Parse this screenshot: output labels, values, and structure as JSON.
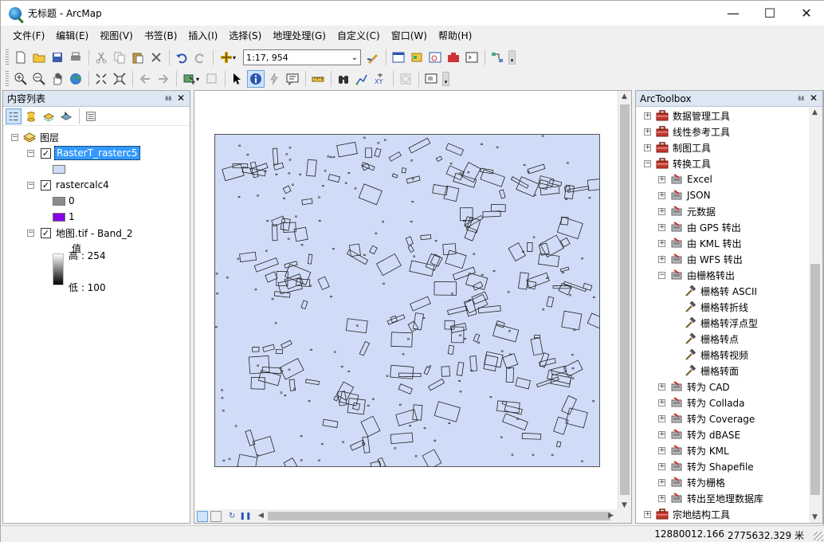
{
  "window": {
    "title": "无标题 - ArcMap"
  },
  "menu": [
    "文件(F)",
    "编辑(E)",
    "视图(V)",
    "书签(B)",
    "插入(I)",
    "选择(S)",
    "地理处理(G)",
    "自定义(C)",
    "窗口(W)",
    "帮助(H)"
  ],
  "toolbar": {
    "scale": "1:17, 954"
  },
  "toc": {
    "title": "内容列表",
    "root": "图层",
    "layers": [
      {
        "name": "RasterT_rasterc5",
        "selected": true
      },
      {
        "name": "rastercalc4",
        "legend": [
          "0",
          "1"
        ]
      },
      {
        "name": "地图.tif - Band_2",
        "value_label": "值",
        "high": "高 : 254",
        "low": "低 : 100"
      }
    ],
    "colors": {
      "raster5_fill": "#d0dcf7",
      "class0": "#8c8c8c",
      "class1": "#8a00e6"
    }
  },
  "toolbox": {
    "title": "ArcToolbox",
    "items": [
      {
        "label": "数据管理工具",
        "level": 0,
        "expander": "+"
      },
      {
        "label": "线性参考工具",
        "level": 0,
        "expander": "+"
      },
      {
        "label": "制图工具",
        "level": 0,
        "expander": "+"
      },
      {
        "label": "转换工具",
        "level": 0,
        "expander": "-"
      },
      {
        "label": "Excel",
        "level": 1,
        "expander": "+"
      },
      {
        "label": "JSON",
        "level": 1,
        "expander": "+"
      },
      {
        "label": "元数据",
        "level": 1,
        "expander": "+"
      },
      {
        "label": "由 GPS 转出",
        "level": 1,
        "expander": "+"
      },
      {
        "label": "由 KML 转出",
        "level": 1,
        "expander": "+"
      },
      {
        "label": "由 WFS 转出",
        "level": 1,
        "expander": "+"
      },
      {
        "label": "由栅格转出",
        "level": 1,
        "expander": "-"
      },
      {
        "label": "栅格转 ASCII",
        "level": 2
      },
      {
        "label": "栅格转折线",
        "level": 2
      },
      {
        "label": "栅格转浮点型",
        "level": 2
      },
      {
        "label": "栅格转点",
        "level": 2
      },
      {
        "label": "栅格转视频",
        "level": 2
      },
      {
        "label": "栅格转面",
        "level": 2
      },
      {
        "label": "转为 CAD",
        "level": 1,
        "expander": "+"
      },
      {
        "label": "转为 Collada",
        "level": 1,
        "expander": "+"
      },
      {
        "label": "转为 Coverage",
        "level": 1,
        "expander": "+"
      },
      {
        "label": "转为 dBASE",
        "level": 1,
        "expander": "+"
      },
      {
        "label": "转为 KML",
        "level": 1,
        "expander": "+"
      },
      {
        "label": "转为 Shapefile",
        "level": 1,
        "expander": "+"
      },
      {
        "label": "转为栅格",
        "level": 1,
        "expander": "+"
      },
      {
        "label": "转出至地理数据库",
        "level": 1,
        "expander": "+"
      },
      {
        "label": "宗地结构工具",
        "level": 0,
        "expander": "+"
      }
    ]
  },
  "status": {
    "x": "12880012.166",
    "y": "2775632.329 米"
  }
}
